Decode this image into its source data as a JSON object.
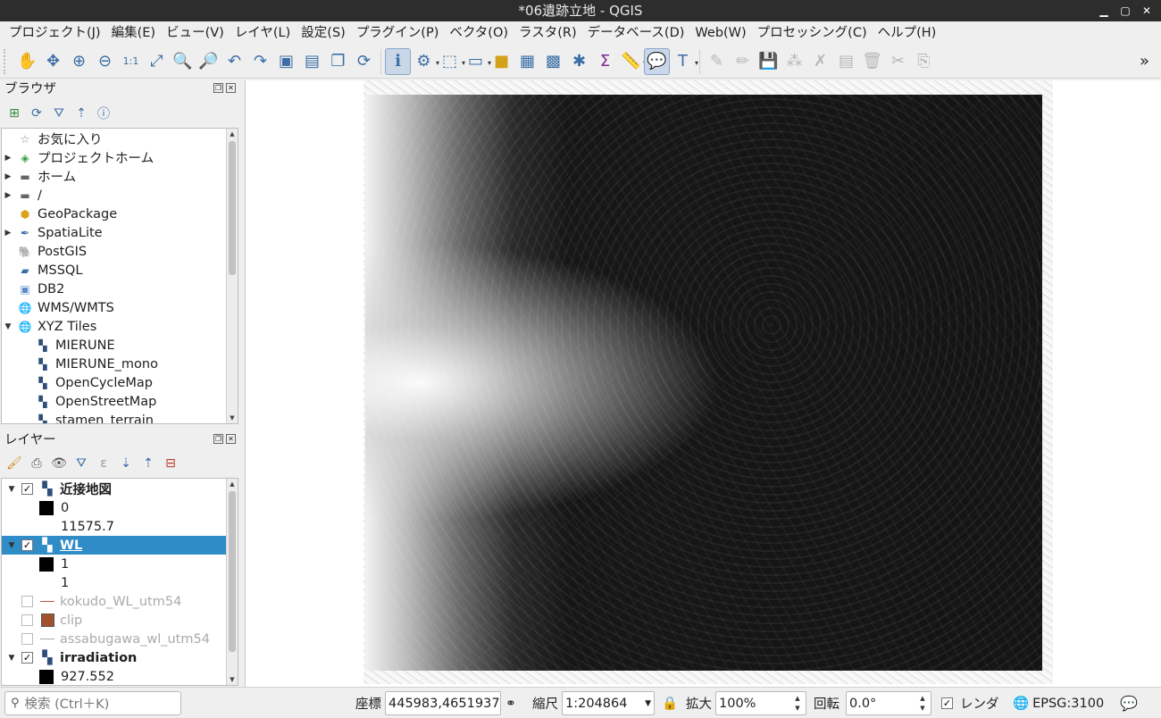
{
  "window": {
    "title": "*06遺跡立地 - QGIS"
  },
  "menu": [
    "プロジェクト(J)",
    "編集(E)",
    "ビュー(V)",
    "レイヤ(L)",
    "設定(S)",
    "プラグイン(P)",
    "ベクタ(O)",
    "ラスタ(R)",
    "データベース(D)",
    "Web(W)",
    "プロセッシング(C)",
    "ヘルプ(H)"
  ],
  "toolbar": {
    "overflow": "»"
  },
  "browser": {
    "title": "ブラウザ",
    "items": [
      {
        "label": "お気に入り",
        "icon": "star-icon",
        "expandable": false
      },
      {
        "label": "プロジェクトホーム",
        "icon": "qgis-project-icon",
        "expandable": true
      },
      {
        "label": "ホーム",
        "icon": "folder-icon",
        "expandable": true
      },
      {
        "label": "/",
        "icon": "folder-icon",
        "expandable": true
      },
      {
        "label": "GeoPackage",
        "icon": "geopackage-icon",
        "expandable": false
      },
      {
        "label": "SpatiaLite",
        "icon": "spatialite-icon",
        "expandable": true
      },
      {
        "label": "PostGIS",
        "icon": "postgis-icon",
        "expandable": false
      },
      {
        "label": "MSSQL",
        "icon": "mssql-icon",
        "expandable": false
      },
      {
        "label": "DB2",
        "icon": "db2-icon",
        "expandable": false
      },
      {
        "label": "WMS/WMTS",
        "icon": "globe-icon",
        "expandable": false
      },
      {
        "label": "XYZ Tiles",
        "icon": "globe-icon",
        "expandable": true,
        "expanded": true
      },
      {
        "label": "MIERUNE",
        "icon": "tile-icon",
        "child": true
      },
      {
        "label": "MIERUNE_mono",
        "icon": "tile-icon",
        "child": true
      },
      {
        "label": "OpenCycleMap",
        "icon": "tile-icon",
        "child": true
      },
      {
        "label": "OpenStreetMap",
        "icon": "tile-icon",
        "child": true
      },
      {
        "label": "stamen_terrain",
        "icon": "tile-icon",
        "child": true
      }
    ]
  },
  "layers": {
    "title": "レイヤー",
    "items": [
      {
        "label": "近接地図",
        "type": "raster",
        "checked": true,
        "bold": true
      },
      {
        "label": "0",
        "type": "legend-swatch",
        "color": "#000000"
      },
      {
        "label": "11575.7",
        "type": "legend-text"
      },
      {
        "label": "WL",
        "type": "raster",
        "checked": true,
        "bold": true,
        "selected": true
      },
      {
        "label": "1",
        "type": "legend-swatch",
        "color": "#000000"
      },
      {
        "label": "1",
        "type": "legend-text"
      },
      {
        "label": "kokudo_WL_utm54",
        "type": "line",
        "checked": false,
        "color": "#c0504d"
      },
      {
        "label": "clip",
        "type": "polygon",
        "checked": false,
        "color": "#a0522d"
      },
      {
        "label": "assabugawa_wl_utm54",
        "type": "line",
        "checked": false,
        "color": "#aaaaaa"
      },
      {
        "label": "irradiation",
        "type": "raster",
        "checked": true,
        "bold": true
      },
      {
        "label": "927.552",
        "type": "legend-swatch",
        "color": "#000000"
      }
    ]
  },
  "status": {
    "search_placeholder": "検索 (Ctrl＋K)",
    "coord_label": "座標",
    "coord_value": "445983,4651937",
    "scale_label": "縮尺",
    "scale_value": "1:204864",
    "magnifier_label": "拡大",
    "magnifier_value": "100%",
    "rotation_label": "回転",
    "rotation_value": "0.0°",
    "render_label": "レンダ",
    "crs": "EPSG:3100"
  }
}
